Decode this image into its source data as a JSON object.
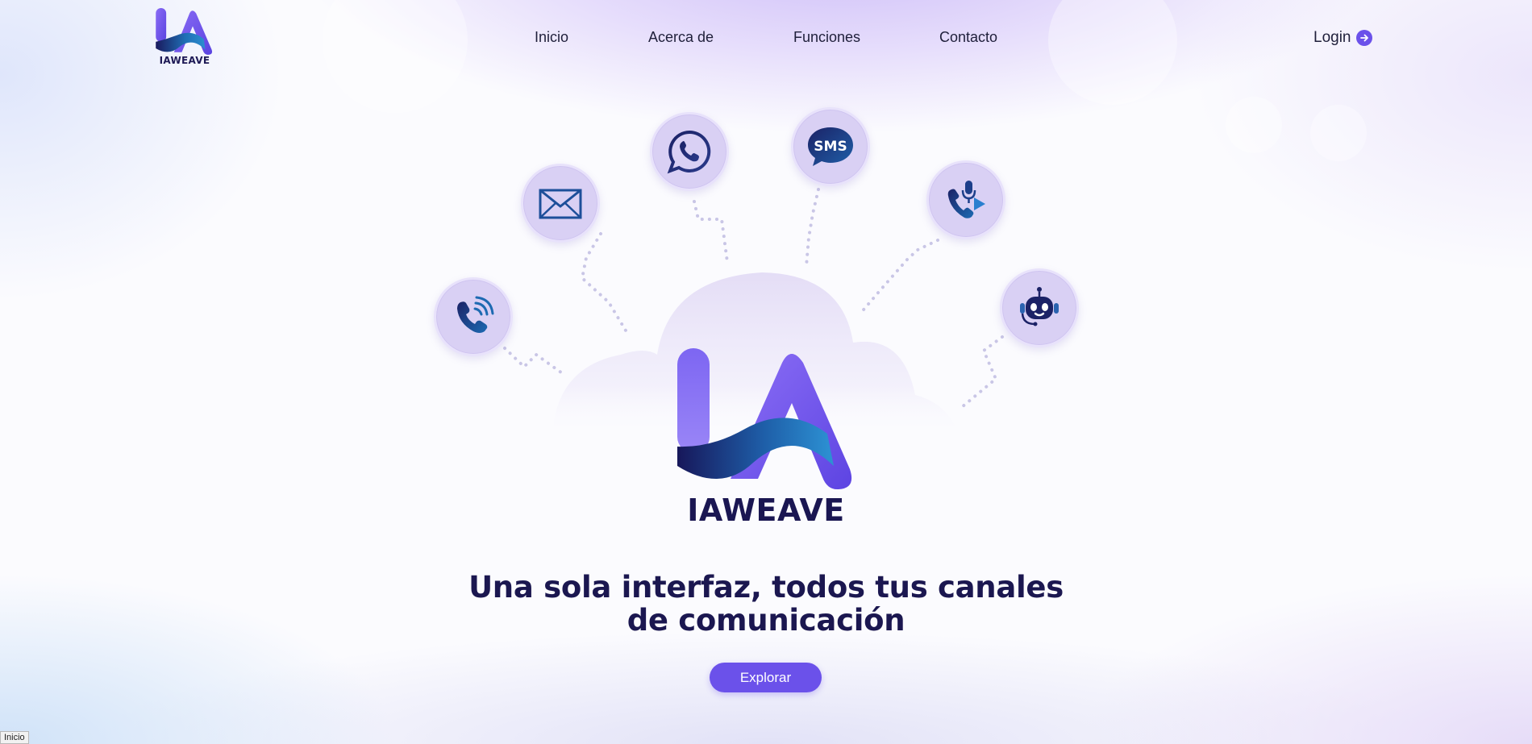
{
  "brand": {
    "name": "IAWEAVE"
  },
  "nav": {
    "items": [
      "Inicio",
      "Acerca de",
      "Funciones",
      "Contacto"
    ]
  },
  "login": {
    "label": "Login"
  },
  "hero": {
    "logo_text": "IAWEAVE",
    "headline_line1": "Una sola interfaz, todos tus canales",
    "headline_line2": "de comunicación",
    "cta_label": "Explorar"
  },
  "channels": [
    {
      "icon": "phone-call-icon"
    },
    {
      "icon": "mail-icon"
    },
    {
      "icon": "whatsapp-icon"
    },
    {
      "icon": "sms-icon",
      "text": "SMS"
    },
    {
      "icon": "voice-call-icon"
    },
    {
      "icon": "robot-icon"
    }
  ],
  "status_bar": {
    "text": "Inicio"
  },
  "colors": {
    "accent": "#6b51ea",
    "navy": "#1b1750",
    "icon_circle": "#d9d0f4"
  }
}
